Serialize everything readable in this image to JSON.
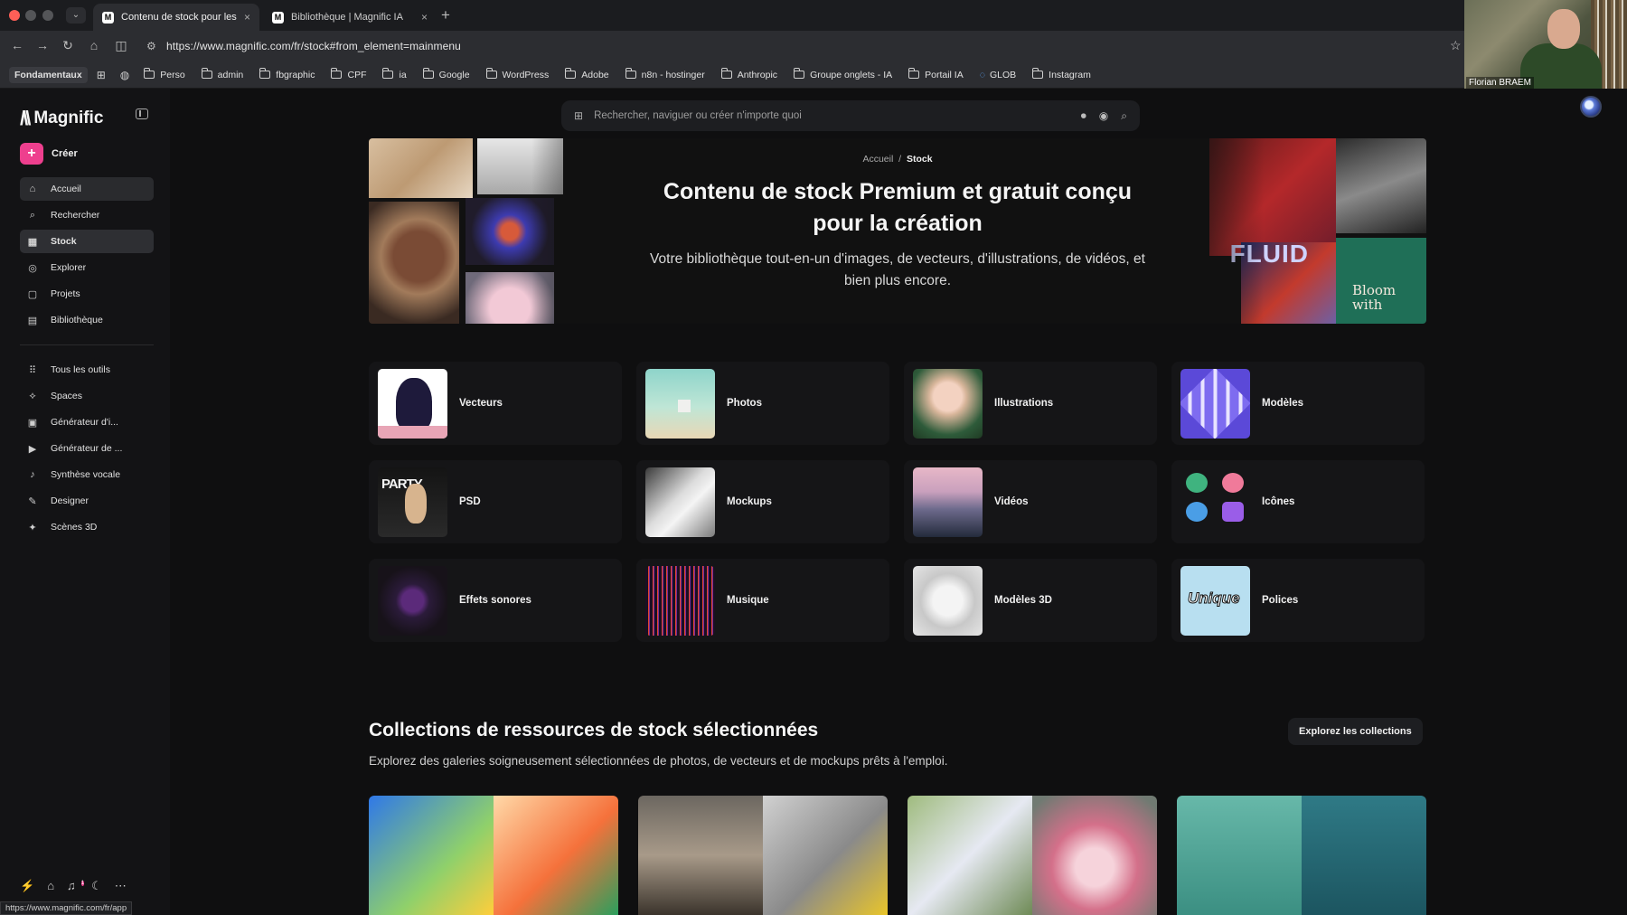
{
  "browser": {
    "tabs": [
      {
        "title": "Contenu de stock pour les cr",
        "active": true
      },
      {
        "title": "Bibliothèque | Magnific IA",
        "active": false
      }
    ],
    "url": "https://www.magnific.com/fr/stock#from_element=mainmenu",
    "bookmarks": [
      "Fondamentaux",
      "Perso",
      "admin",
      "fbgraphic",
      "CPF",
      "ia",
      "Google",
      "WordPress",
      "Adobe",
      "n8n - hostinger",
      "Anthropic",
      "Groupe onglets - IA",
      "Portail IA",
      "GLOB",
      "Instagram"
    ],
    "status_url": "https://www.magnific.com/fr/app",
    "webcam_name": "Florian BRAEM"
  },
  "sidebar": {
    "brand": "Magnific",
    "create_label": "Créer",
    "nav": [
      {
        "label": "Accueil",
        "icon": "home-icon",
        "glyph": "⌂"
      },
      {
        "label": "Rechercher",
        "icon": "search-icon",
        "glyph": "⌕"
      },
      {
        "label": "Stock",
        "icon": "stock-icon",
        "glyph": "▦"
      },
      {
        "label": "Explorer",
        "icon": "compass-icon",
        "glyph": "◎"
      },
      {
        "label": "Projets",
        "icon": "projects-icon",
        "glyph": "▢"
      },
      {
        "label": "Bibliothèque",
        "icon": "library-icon",
        "glyph": "▤"
      }
    ],
    "tools": [
      {
        "label": "Tous les outils",
        "icon": "apps-grid-icon",
        "glyph": "⠿"
      },
      {
        "label": "Spaces",
        "icon": "spaces-icon",
        "glyph": "⟡"
      },
      {
        "label": "Générateur d'i...",
        "icon": "image-generator-icon",
        "glyph": "▣"
      },
      {
        "label": "Générateur de ...",
        "icon": "video-generator-icon",
        "glyph": "▶"
      },
      {
        "label": "Synthèse vocale",
        "icon": "microphone-icon",
        "glyph": "♪"
      },
      {
        "label": "Designer",
        "icon": "designer-icon",
        "glyph": "✎"
      },
      {
        "label": "Scènes 3D",
        "icon": "3d-scene-icon",
        "glyph": "✦"
      }
    ],
    "notification_count": "1"
  },
  "search": {
    "placeholder": "Rechercher, naviguer ou créer n'importe quoi"
  },
  "hero": {
    "breadcrumb_home": "Accueil",
    "breadcrumb_sep": "/",
    "breadcrumb_current": "Stock",
    "title": "Contenu de stock Premium et gratuit conçu pour la création",
    "subtitle": "Votre bibliothèque tout-en-un d'images, de vecteurs, d'illustrations, de vidéos, et bien plus encore.",
    "image_text_fluid": "FLUID",
    "image_text_bloom": "Bloom with"
  },
  "categories": [
    {
      "label": "Vecteurs",
      "thumb": "th-vect"
    },
    {
      "label": "Photos",
      "thumb": "th-photo"
    },
    {
      "label": "Illustrations",
      "thumb": "th-illu"
    },
    {
      "label": "Modèles",
      "thumb": "th-model"
    },
    {
      "label": "PSD",
      "thumb": "th-psd"
    },
    {
      "label": "Mockups",
      "thumb": "th-mock"
    },
    {
      "label": "Vidéos",
      "thumb": "th-video"
    },
    {
      "label": "Icônes",
      "thumb": "th-icons"
    },
    {
      "label": "Effets sonores",
      "thumb": "th-sfx"
    },
    {
      "label": "Musique",
      "thumb": "th-music"
    },
    {
      "label": "Modèles 3D",
      "thumb": "th-3d"
    },
    {
      "label": "Polices",
      "thumb": "th-font"
    }
  ],
  "collections": {
    "title": "Collections de ressources de stock sélectionnées",
    "subtitle": "Explorez des galeries soigneusement sélectionnées de photos, de vecteurs et de mockups prêts à l'emploi.",
    "explore_label": "Explorez les collections"
  },
  "colors": {
    "accent": "#ee3f8e",
    "background": "#0f0f10",
    "sidebar": "#131315",
    "card": "#151517"
  }
}
